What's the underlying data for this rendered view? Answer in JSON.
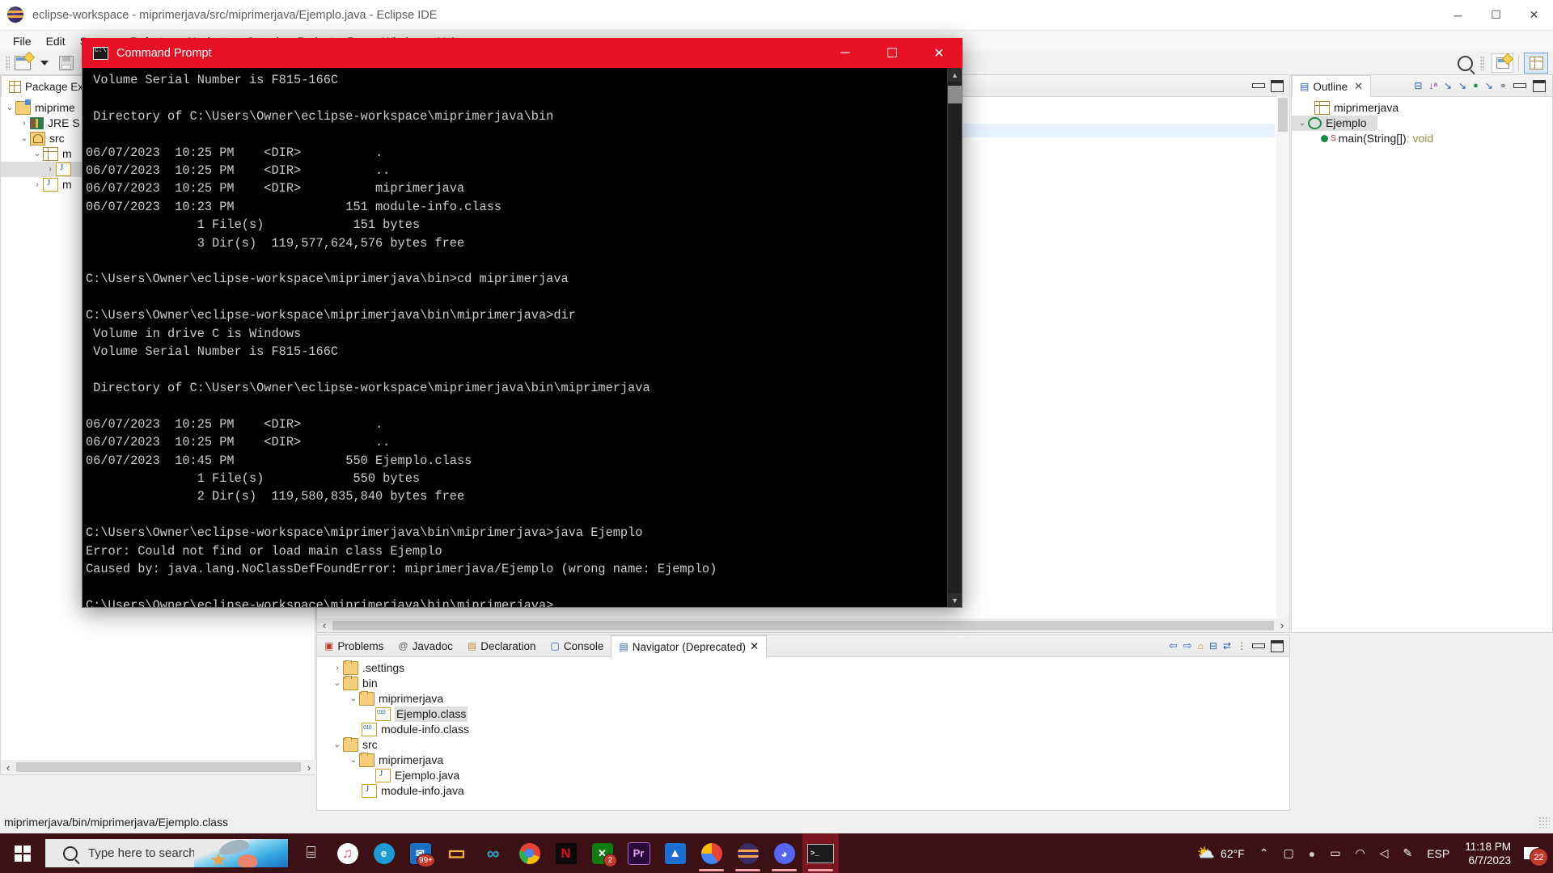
{
  "window": {
    "title": "eclipse-workspace - miprimerjava/src/miprimerjava/Ejemplo.java - Eclipse IDE",
    "minimize": "─",
    "maximize": "☐",
    "close": "✕"
  },
  "menubar": [
    "File",
    "Edit",
    "Source",
    "Refactor",
    "Navigate",
    "Search",
    "Project",
    "Run",
    "Window",
    "Help"
  ],
  "package_explorer": {
    "tab_label": "Package Ex",
    "items": [
      {
        "label": "miprime",
        "arrow": "⌄",
        "icon": "project-icon",
        "indent": 0,
        "selected": false
      },
      {
        "label": "JRE S",
        "arrow": "›",
        "icon": "library-icon",
        "indent": 1,
        "selected": false
      },
      {
        "label": "src",
        "arrow": "⌄",
        "icon": "source-folder-icon",
        "indent": 1,
        "selected": false
      },
      {
        "label": "m",
        "arrow": "⌄",
        "icon": "package-icon",
        "indent": 2,
        "selected": false
      },
      {
        "label": "",
        "arrow": "›",
        "icon": "java-file-icon",
        "indent": 3,
        "selected": true
      },
      {
        "label": "m",
        "arrow": "›",
        "icon": "java-file-icon",
        "indent": 2,
        "selected": false
      }
    ]
  },
  "outline": {
    "tab_label": "Outline",
    "close": "✕",
    "items": [
      {
        "label": "miprimerjava",
        "type": "package",
        "indent": 1,
        "arrow": "",
        "selected": false
      },
      {
        "label": "Ejemplo",
        "type": "class",
        "indent": 0,
        "arrow": "⌄",
        "selected": true
      },
      {
        "label": "main(String[])",
        "suffix": " : void",
        "type": "method",
        "indent": 2,
        "arrow": "",
        "selected": false
      }
    ]
  },
  "bottom_panel": {
    "tabs": [
      {
        "label": "Problems",
        "icon": "problems-icon",
        "active": false
      },
      {
        "label": "Javadoc",
        "icon": "javadoc-icon",
        "active": false
      },
      {
        "label": "Declaration",
        "icon": "declaration-icon",
        "active": false
      },
      {
        "label": "Console",
        "icon": "console-icon",
        "active": false
      },
      {
        "label": "Navigator (Deprecated)",
        "icon": "navigator-icon",
        "active": true,
        "close": "✕"
      }
    ],
    "tree": [
      {
        "label": ".settings",
        "arrow": "›",
        "icon": "folder-icon",
        "indent": 1,
        "selected": false
      },
      {
        "label": "bin",
        "arrow": "⌄",
        "icon": "folder-icon",
        "indent": 1,
        "selected": false
      },
      {
        "label": "miprimerjava",
        "arrow": "⌄",
        "icon": "folder-icon",
        "indent": 2,
        "selected": false
      },
      {
        "label": "Ejemplo.class",
        "arrow": "",
        "icon": "class-file-icon",
        "indent": 3,
        "selected": true
      },
      {
        "label": "module-info.class",
        "arrow": "",
        "icon": "class-file-icon",
        "indent": 2,
        "selected": false
      },
      {
        "label": "src",
        "arrow": "⌄",
        "icon": "folder-icon",
        "indent": 1,
        "selected": false
      },
      {
        "label": "miprimerjava",
        "arrow": "⌄",
        "icon": "folder-icon",
        "indent": 2,
        "selected": false
      },
      {
        "label": "Ejemplo.java",
        "arrow": "",
        "icon": "java-file-icon",
        "indent": 3,
        "selected": false
      },
      {
        "label": "module-info.java",
        "arrow": "",
        "icon": "java-file-icon",
        "indent": 2,
        "selected": false
      }
    ]
  },
  "statusbar": {
    "text": "miprimerjava/bin/miprimerjava/Ejemplo.class"
  },
  "command_prompt": {
    "title": "Command Prompt",
    "minimize": "─",
    "maximize": "☐",
    "close": "✕",
    "scroll_up": "▲",
    "scroll_down": "▼",
    "content": " Volume Serial Number is F815-166C\n\n Directory of C:\\Users\\Owner\\eclipse-workspace\\miprimerjava\\bin\n\n06/07/2023  10:25 PM    <DIR>          .\n06/07/2023  10:25 PM    <DIR>          ..\n06/07/2023  10:25 PM    <DIR>          miprimerjava\n06/07/2023  10:23 PM               151 module-info.class\n               1 File(s)            151 bytes\n               3 Dir(s)  119,577,624,576 bytes free\n\nC:\\Users\\Owner\\eclipse-workspace\\miprimerjava\\bin>cd miprimerjava\n\nC:\\Users\\Owner\\eclipse-workspace\\miprimerjava\\bin\\miprimerjava>dir\n Volume in drive C is Windows\n Volume Serial Number is F815-166C\n\n Directory of C:\\Users\\Owner\\eclipse-workspace\\miprimerjava\\bin\\miprimerjava\n\n06/07/2023  10:25 PM    <DIR>          .\n06/07/2023  10:25 PM    <DIR>          ..\n06/07/2023  10:45 PM               550 Ejemplo.class\n               1 File(s)            550 bytes\n               2 Dir(s)  119,580,835,840 bytes free\n\nC:\\Users\\Owner\\eclipse-workspace\\miprimerjava\\bin\\miprimerjava>java Ejemplo\nError: Could not find or load main class Ejemplo\nCaused by: java.lang.NoClassDefFoundError: miprimerjava/Ejemplo (wrong name: Ejemplo)\n\nC:\\Users\\Owner\\eclipse-workspace\\miprimerjava\\bin\\miprimerjava>"
  },
  "taskbar": {
    "search_placeholder": "Type here to search",
    "apps": [
      {
        "name": "task-view-icon",
        "glyph": "⌸",
        "color": "#ffffff",
        "bg": "transparent",
        "badge": ""
      },
      {
        "name": "itunes-icon",
        "glyph": "♫",
        "color": "#e0527a",
        "bg": "#ffffff",
        "badge": ""
      },
      {
        "name": "edge-icon",
        "glyph": "e",
        "color": "#ffffff",
        "bg": "#1e9ad6",
        "badge": ""
      },
      {
        "name": "mail-icon",
        "glyph": "✉",
        "color": "#ffffff",
        "bg": "#1a6fc4",
        "badge": "99+"
      },
      {
        "name": "file-explorer-icon",
        "glyph": "▭",
        "color": "#f3b33d",
        "bg": "transparent",
        "badge": ""
      },
      {
        "name": "infinity-icon",
        "glyph": "∞",
        "color": "#2aa9c4",
        "bg": "transparent",
        "badge": ""
      },
      {
        "name": "chrome-icon",
        "glyph": "●",
        "color": "#ffffff",
        "bg": "#34a853",
        "badge": ""
      },
      {
        "name": "netflix-icon",
        "glyph": "N",
        "color": "#e50914",
        "bg": "#0b0b0b",
        "badge": ""
      },
      {
        "name": "xbox-icon",
        "glyph": "✕",
        "color": "#ffffff",
        "bg": "#107c10",
        "badge": "2"
      },
      {
        "name": "premiere-pro-icon",
        "glyph": "Pr",
        "color": "#e6a5f5",
        "bg": "#2a0a38",
        "badge": ""
      },
      {
        "name": "acrobat-icon",
        "glyph": "▲",
        "color": "#ffffff",
        "bg": "#1b6fd0",
        "badge": ""
      },
      {
        "name": "chrome-beta-icon",
        "glyph": "●",
        "color": "#ffffff",
        "bg": "#e8453c",
        "badge": ""
      },
      {
        "name": "eclipse-icon",
        "glyph": "●",
        "color": "#f3a847",
        "bg": "#3b2a63",
        "badge": ""
      },
      {
        "name": "discord-icon",
        "glyph": "●",
        "color": "#ffffff",
        "bg": "#5865f2",
        "badge": ""
      },
      {
        "name": "command-prompt-icon",
        "glyph": "■",
        "color": "#ffffff",
        "bg": "#1c1c1c",
        "badge": ""
      }
    ],
    "weather": {
      "temp": "62°F"
    },
    "tray": {
      "chevron": "⌃",
      "camera": "▢",
      "meet": "●",
      "battery": "▭",
      "wifi": "◠",
      "volume": "◁",
      "pen": "✎",
      "language": "ESP"
    },
    "clock": {
      "time": "11:18 PM",
      "date": "6/7/2023"
    },
    "notifications": {
      "count": "22"
    }
  },
  "colors": {
    "cmd_titlebar": "#e81123",
    "taskbar": "#3b1116",
    "selection": "#dedede",
    "editor_highlight": "#e8f2fe"
  }
}
